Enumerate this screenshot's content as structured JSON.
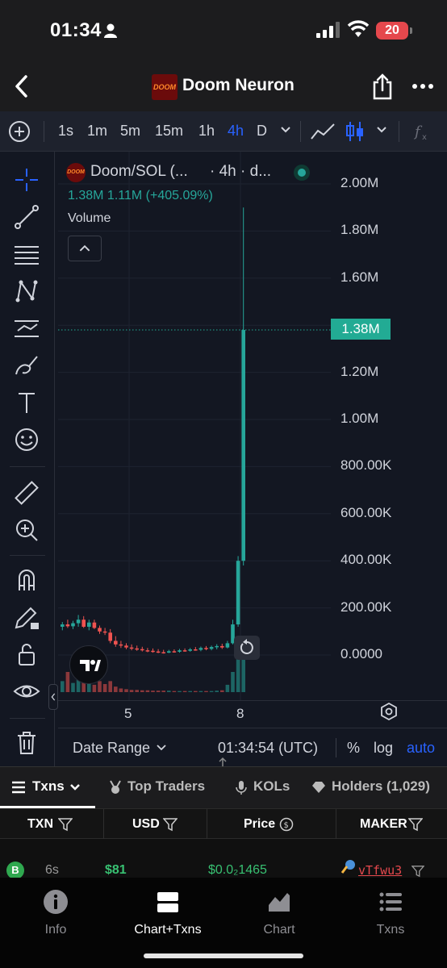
{
  "status_bar": {
    "time": "01:34",
    "battery": "20"
  },
  "header": {
    "token_name": "Doom Neuron",
    "logo_text": "DOOM"
  },
  "intervals": {
    "items": [
      "1s",
      "1m",
      "5m",
      "15m",
      "1h",
      "4h",
      "D"
    ],
    "active": "4h"
  },
  "legend": {
    "pair": "Doom/SOL (...",
    "interval": "· 4h · d...",
    "values": "1.38M  1.11M (+405.09%)",
    "volume_label": "Volume"
  },
  "chart_data": {
    "type": "candlestick",
    "y_ticks": [
      "2.00M",
      "1.80M",
      "1.60M",
      "1.40M",
      "1.20M",
      "1.00M",
      "800.00K",
      "600.00K",
      "400.00K",
      "200.00K",
      "0.0000"
    ],
    "ylim": [
      0,
      2000000
    ],
    "x_ticks": [
      "5",
      "8"
    ],
    "current_price_label": "1.38M",
    "current_price": 1380000,
    "candles": [
      {
        "o": 120000,
        "h": 140000,
        "l": 105000,
        "c": 130000
      },
      {
        "o": 130000,
        "h": 150000,
        "l": 115000,
        "c": 122000
      },
      {
        "o": 122000,
        "h": 145000,
        "l": 110000,
        "c": 135000
      },
      {
        "o": 135000,
        "h": 170000,
        "l": 120000,
        "c": 150000
      },
      {
        "o": 150000,
        "h": 165000,
        "l": 115000,
        "c": 120000
      },
      {
        "o": 120000,
        "h": 150000,
        "l": 105000,
        "c": 138000
      },
      {
        "o": 138000,
        "h": 150000,
        "l": 110000,
        "c": 115000
      },
      {
        "o": 115000,
        "h": 125000,
        "l": 90000,
        "c": 100000
      },
      {
        "o": 100000,
        "h": 115000,
        "l": 85000,
        "c": 95000
      },
      {
        "o": 95000,
        "h": 110000,
        "l": 50000,
        "c": 60000
      },
      {
        "o": 60000,
        "h": 80000,
        "l": 35000,
        "c": 45000
      },
      {
        "o": 45000,
        "h": 60000,
        "l": 30000,
        "c": 40000
      },
      {
        "o": 40000,
        "h": 50000,
        "l": 25000,
        "c": 32000
      },
      {
        "o": 32000,
        "h": 45000,
        "l": 20000,
        "c": 28000
      },
      {
        "o": 28000,
        "h": 40000,
        "l": 18000,
        "c": 25000
      },
      {
        "o": 25000,
        "h": 35000,
        "l": 15000,
        "c": 20000
      },
      {
        "o": 20000,
        "h": 30000,
        "l": 12000,
        "c": 18000
      },
      {
        "o": 18000,
        "h": 28000,
        "l": 10000,
        "c": 15000
      },
      {
        "o": 15000,
        "h": 25000,
        "l": 8000,
        "c": 12000
      },
      {
        "o": 12000,
        "h": 22000,
        "l": 6000,
        "c": 10000
      },
      {
        "o": 10000,
        "h": 22000,
        "l": 8000,
        "c": 16000
      },
      {
        "o": 16000,
        "h": 24000,
        "l": 10000,
        "c": 14000
      },
      {
        "o": 14000,
        "h": 26000,
        "l": 10000,
        "c": 20000
      },
      {
        "o": 20000,
        "h": 28000,
        "l": 14000,
        "c": 18000
      },
      {
        "o": 18000,
        "h": 30000,
        "l": 14000,
        "c": 24000
      },
      {
        "o": 24000,
        "h": 34000,
        "l": 18000,
        "c": 22000
      },
      {
        "o": 22000,
        "h": 36000,
        "l": 16000,
        "c": 30000
      },
      {
        "o": 30000,
        "h": 38000,
        "l": 20000,
        "c": 26000
      },
      {
        "o": 26000,
        "h": 40000,
        "l": 20000,
        "c": 34000
      },
      {
        "o": 34000,
        "h": 46000,
        "l": 24000,
        "c": 38000
      },
      {
        "o": 38000,
        "h": 48000,
        "l": 26000,
        "c": 32000
      },
      {
        "o": 32000,
        "h": 60000,
        "l": 28000,
        "c": 50000
      },
      {
        "o": 50000,
        "h": 150000,
        "l": 45000,
        "c": 130000
      },
      {
        "o": 130000,
        "h": 420000,
        "l": 120000,
        "c": 400000
      },
      {
        "o": 400000,
        "h": 1900000,
        "l": 380000,
        "c": 1380000
      }
    ],
    "volume": [
      30,
      55,
      25,
      40,
      30,
      45,
      20,
      30,
      22,
      30,
      15,
      10,
      8,
      6,
      6,
      5,
      5,
      4,
      4,
      4,
      4,
      3,
      3,
      3,
      3,
      3,
      3,
      3,
      3,
      4,
      5,
      20,
      55,
      90,
      110
    ]
  },
  "bottom_bar": {
    "date_range": "Date Range",
    "time": "01:34:54 (UTC)",
    "percent": "%",
    "log": "log",
    "auto": "auto"
  },
  "tabs": [
    "Txns",
    "Top Traders",
    "KOLs",
    "Holders (1,029)"
  ],
  "table": {
    "headers": [
      "TXN",
      "USD",
      "Price",
      "MAKER"
    ],
    "row": {
      "type": "B",
      "age": "6s",
      "usd": "$81",
      "price": "$0.0₂1465",
      "maker": "vTfwu3"
    }
  },
  "nav": [
    "Info",
    "Chart+Txns",
    "Chart",
    "Txns"
  ],
  "colors": {
    "up": "#26a69a",
    "down": "#ef5350",
    "accent": "#2962ff"
  }
}
